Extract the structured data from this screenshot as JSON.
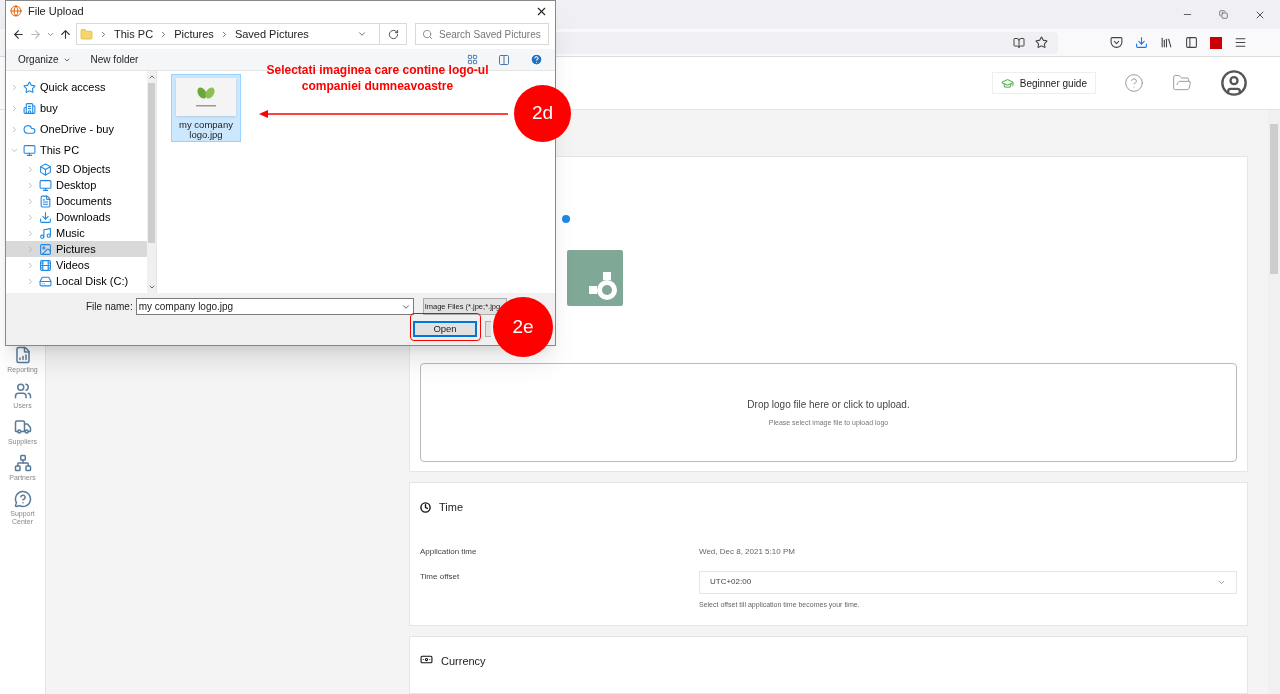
{
  "dialog": {
    "title": "File Upload",
    "breadcrumbs": [
      "This PC",
      "Pictures",
      "Saved Pictures"
    ],
    "search": {
      "placeholder": "Search Saved Pictures"
    },
    "commands": [
      "Organize",
      "New folder"
    ],
    "nav": [
      {
        "label": "Quick access",
        "expanded": false,
        "selected": false
      },
      {
        "label": "buy",
        "expanded": false,
        "selected": false
      },
      {
        "label": "OneDrive - buy",
        "expanded": false,
        "selected": false
      },
      {
        "label": "This PC",
        "expanded": true,
        "selected": false,
        "children": [
          {
            "label": "3D Objects",
            "expanded": false,
            "selected": false
          },
          {
            "label": "Desktop",
            "expanded": false,
            "selected": false
          },
          {
            "label": "Documents",
            "expanded": false,
            "selected": false
          },
          {
            "label": "Downloads",
            "expanded": false,
            "selected": false
          },
          {
            "label": "Music",
            "expanded": false,
            "selected": false
          },
          {
            "label": "Pictures",
            "expanded": false,
            "selected": true
          },
          {
            "label": "Videos",
            "expanded": false,
            "selected": false
          },
          {
            "label": "Local Disk (C:)",
            "expanded": false,
            "selected": false
          }
        ]
      }
    ],
    "files": [
      {
        "name": "my company logo.jpg",
        "selected": true
      }
    ],
    "file_name": {
      "label": "File name:",
      "value": "my company logo.jpg"
    },
    "file_type": "Image Files (*.jpe;*.jpg",
    "open_button": "Open"
  },
  "annotations": {
    "note": "Selectati imaginea care contine logo-ul companiei dumneavoastre",
    "steps": [
      "2d",
      "2e"
    ]
  },
  "header": {
    "guide_button": "Beginner guide"
  },
  "sidebar": [
    {
      "label": "Reporting"
    },
    {
      "label": "Users"
    },
    {
      "label": "Suppliers"
    },
    {
      "label": "Partners"
    },
    {
      "label": "Support Center"
    }
  ],
  "logo_card": {
    "dropzone": {
      "title": "Drop logo file here or click to upload.",
      "hint": "Please select image file to upload logo"
    }
  },
  "time_card": {
    "title": "Time",
    "application_time": {
      "label": "Application time",
      "value": "Wed, Dec 8, 2021 5:10 PM"
    },
    "offset": {
      "label": "Time offset",
      "value": "UTC+02:00",
      "help": "Select offset till application time becomes your time."
    }
  },
  "currency_card": {
    "title": "Currency"
  }
}
